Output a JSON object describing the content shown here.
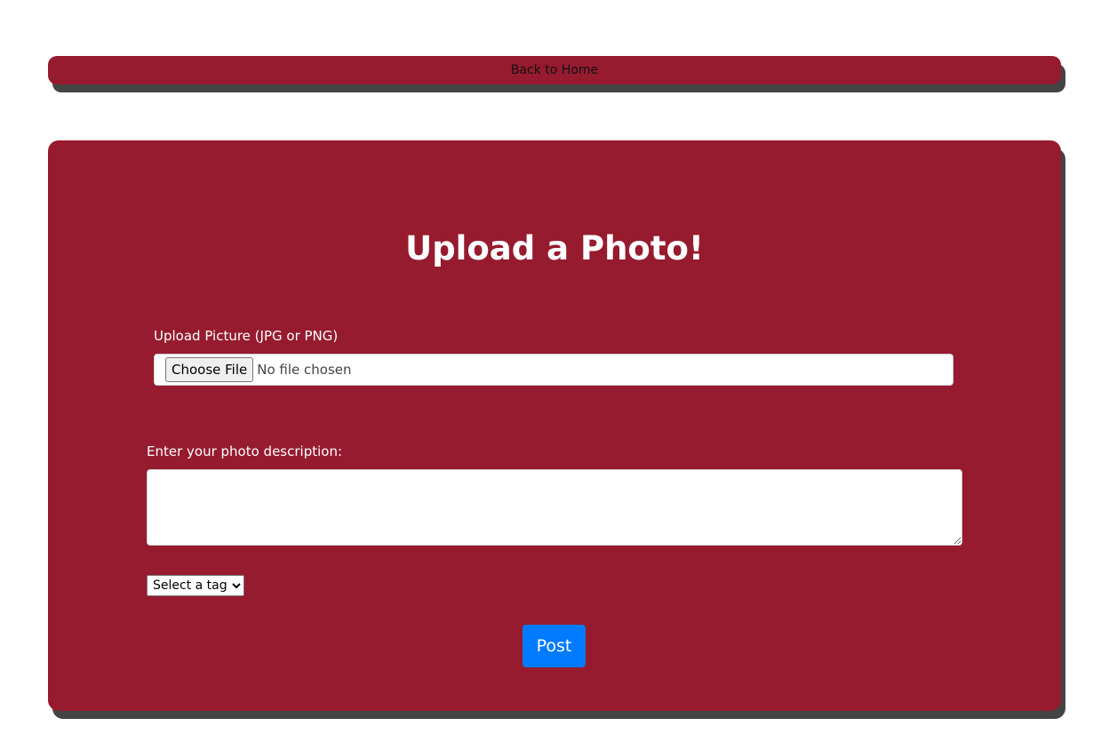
{
  "nav": {
    "back_label": "Back to Home"
  },
  "form": {
    "title": "Upload a Photo!",
    "upload_label": "Upload Picture (JPG or PNG)",
    "choose_file_label": "Choose File",
    "file_status": "No file chosen",
    "description_label": "Enter your photo description:",
    "description_value": "",
    "tag_select": {
      "selected": "Select a tag",
      "options": [
        "Select a tag"
      ]
    },
    "post_label": "Post"
  },
  "colors": {
    "brand": "#961b2f",
    "shadow": "#444444",
    "post_button": "#007bff",
    "background": "#ffffff"
  }
}
